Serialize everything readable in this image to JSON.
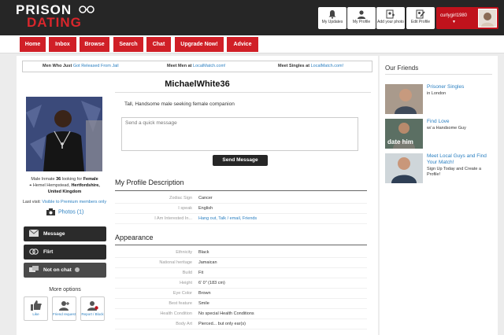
{
  "header": {
    "logo_line1": "PRISON",
    "logo_line2": "DATING",
    "buttons": [
      {
        "label": "My Updates",
        "icon": "bell-icon"
      },
      {
        "label": "My Profile",
        "icon": "user-icon"
      },
      {
        "label": "Add your photo",
        "icon": "add-photo-icon"
      },
      {
        "label": "Edit Profile",
        "icon": "edit-profile-icon"
      }
    ],
    "username": "curlygirl1980",
    "caret": "▼"
  },
  "nav": {
    "items": [
      "Home",
      "Inbox",
      "Browse",
      "Search",
      "Chat",
      "Upgrade Now!",
      "Advice"
    ]
  },
  "promo": [
    {
      "prefix": "Men Who Just ",
      "link": "Got Released From Jail"
    },
    {
      "prefix": "Meet Men at ",
      "link": "LocalMatch.com!"
    },
    {
      "prefix": "Meet Singles at ",
      "link": "LocalMatch.com!"
    }
  ],
  "profile": {
    "username": "MichaelWhite36",
    "tagline": "Tall, Handsome male seeking female companion",
    "message_placeholder": "Send a quick message",
    "send_label": "Send Message",
    "caption_pre": "Male Inmate ",
    "age": "36",
    "caption_mid": " looking for ",
    "seeking": "Female",
    "location_pre": "Hemel Hempstead, ",
    "county": "Hertfordshire,",
    "country": "United Kingdom",
    "last_visit_label": "Last visit: ",
    "last_visit_link": "Visible to Premium members only",
    "photos_label": "Photos (1)"
  },
  "actions": {
    "message": "Message",
    "flirt": "Flirt",
    "chat": "Not on chat",
    "more_options": "More options",
    "like": "Like",
    "friend_request": "Friend request",
    "report": "Report / Block"
  },
  "description": {
    "title": "My Profile Description",
    "rows": [
      {
        "key": "Zodiac Sign",
        "value": "Cancer"
      },
      {
        "key": "I speak",
        "value": "English"
      },
      {
        "key": "I Am Interested In...",
        "value": "Hang out, Talk / email, Friends"
      }
    ]
  },
  "appearance": {
    "title": "Appearance",
    "rows": [
      {
        "key": "Ethnicity",
        "value": "Black"
      },
      {
        "key": "National heritage",
        "value": "Jamaican"
      },
      {
        "key": "Build",
        "value": "Fit"
      },
      {
        "key": "Height",
        "value": "6' 0\" (183 cm)"
      },
      {
        "key": "Eye Color",
        "value": "Brown"
      },
      {
        "key": "Best feature",
        "value": "Smile"
      },
      {
        "key": "Health Condition",
        "value": "No special Health Conditions"
      },
      {
        "key": "Body Art",
        "value": "Pierced... but only ear(s)"
      }
    ]
  },
  "sidebar": {
    "title": "Our Friends",
    "friends": [
      {
        "title": "Prisoner Singles",
        "sub": "in London",
        "overlay": ""
      },
      {
        "title": "Find Love",
        "sub": "w/ a Handsome Guy",
        "overlay": "date him"
      },
      {
        "title": "Meet Local Guys and Find Your Match!",
        "sub": "Sign Up Today and Create a Profile!",
        "overlay": ""
      }
    ]
  },
  "colors": {
    "brand_red": "#d01f27",
    "header_bg": "#262626",
    "link_blue": "#2a7fc1"
  }
}
